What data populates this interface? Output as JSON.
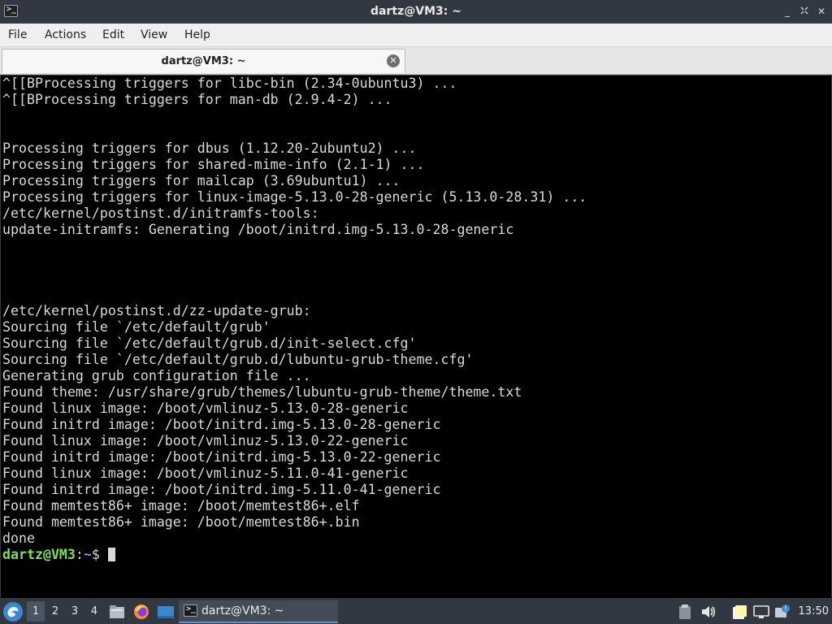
{
  "window": {
    "title": "dartz@VM3: ~",
    "controls": {
      "minimize": "_",
      "maximize": "▫",
      "close": "✕"
    }
  },
  "menu": {
    "file": "File",
    "actions": "Actions",
    "edit": "Edit",
    "view": "View",
    "help": "Help"
  },
  "tab": {
    "label": "dartz@VM3: ~",
    "close": "✕"
  },
  "terminal": {
    "lines": [
      "^[[BProcessing triggers for libc-bin (2.34-0ubuntu3) ...",
      "^[[BProcessing triggers for man-db (2.9.4-2) ...",
      "",
      "",
      "Processing triggers for dbus (1.12.20-2ubuntu2) ...",
      "Processing triggers for shared-mime-info (2.1-1) ...",
      "Processing triggers for mailcap (3.69ubuntu1) ...",
      "Processing triggers for linux-image-5.13.0-28-generic (5.13.0-28.31) ...",
      "/etc/kernel/postinst.d/initramfs-tools:",
      "update-initramfs: Generating /boot/initrd.img-5.13.0-28-generic",
      "",
      "",
      "",
      "",
      "/etc/kernel/postinst.d/zz-update-grub:",
      "Sourcing file `/etc/default/grub'",
      "Sourcing file `/etc/default/grub.d/init-select.cfg'",
      "Sourcing file `/etc/default/grub.d/lubuntu-grub-theme.cfg'",
      "Generating grub configuration file ...",
      "Found theme: /usr/share/grub/themes/lubuntu-grub-theme/theme.txt",
      "Found linux image: /boot/vmlinuz-5.13.0-28-generic",
      "Found initrd image: /boot/initrd.img-5.13.0-28-generic",
      "Found linux image: /boot/vmlinuz-5.13.0-22-generic",
      "Found initrd image: /boot/initrd.img-5.13.0-22-generic",
      "Found linux image: /boot/vmlinuz-5.11.0-41-generic",
      "Found initrd image: /boot/initrd.img-5.11.0-41-generic",
      "Found memtest86+ image: /boot/memtest86+.elf",
      "Found memtest86+ image: /boot/memtest86+.bin",
      "done"
    ],
    "prompt": {
      "user": "dartz@VM3",
      "sep": ":",
      "path": "~",
      "symbol": "$ "
    }
  },
  "taskbar": {
    "workspaces": [
      "1",
      "2",
      "3",
      "4"
    ],
    "active_workspace": "1",
    "task_label": "dartz@VM3: ~",
    "clock": "13:50"
  },
  "colors": {
    "accent": "#3d87c9",
    "prompt_user": "#7be05a",
    "prompt_path": "#6f9bff"
  }
}
